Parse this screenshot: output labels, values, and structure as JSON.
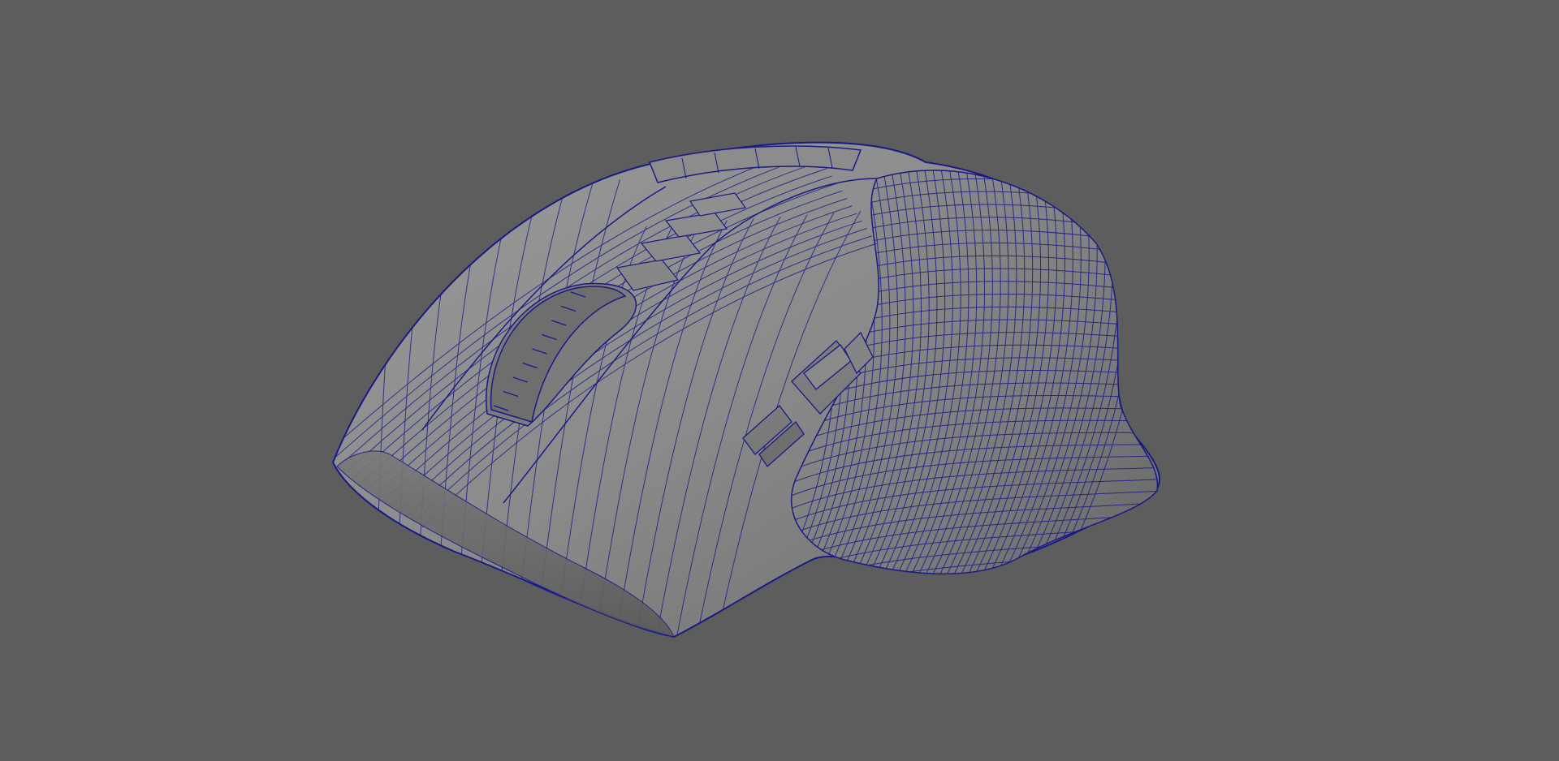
{
  "viewport": {
    "background_color": "#5d5d5d",
    "shading": "wireframe-on-shaded"
  },
  "model": {
    "subject": "computer mouse",
    "surface_color": "#8e8e8e",
    "wireframe_color": "#1a1a86"
  }
}
